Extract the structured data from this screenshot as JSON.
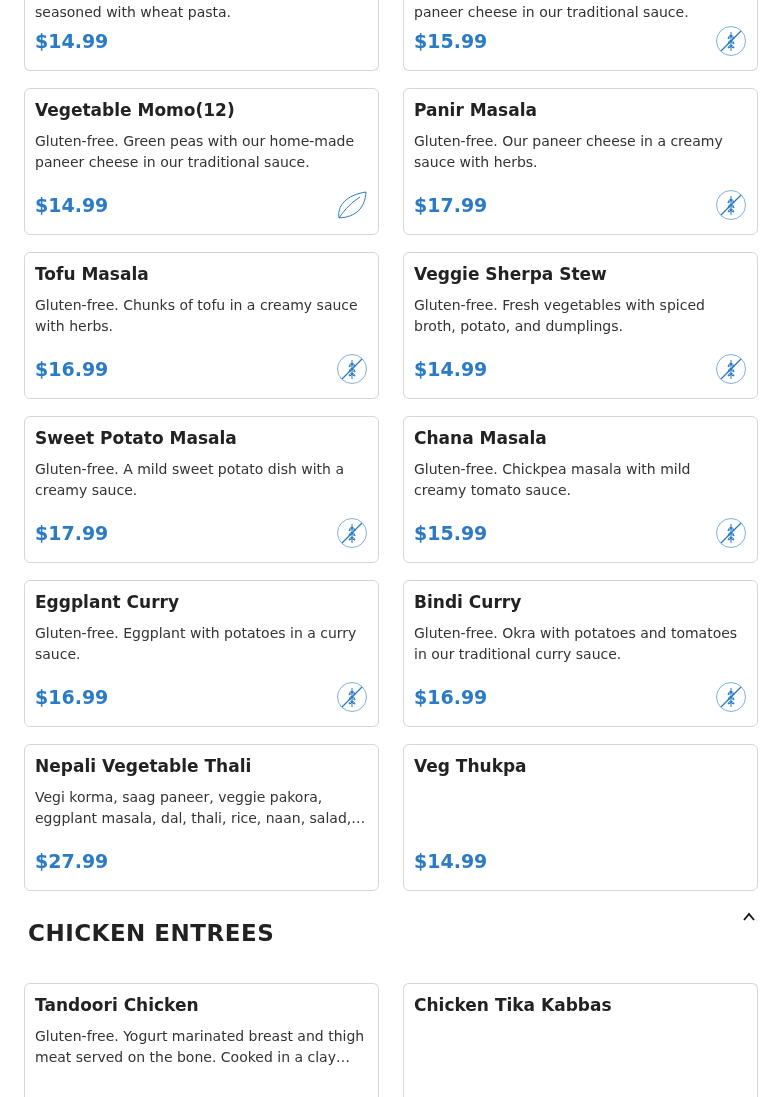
{
  "top_items": [
    {
      "description": "seasoned with wheat pasta.",
      "price": "$14.99",
      "kind": "plain"
    },
    {
      "description": "paneer cheese in our traditional sauce.",
      "price": "$15.99",
      "kind": "gluten_free"
    }
  ],
  "items": [
    {
      "name": "Vegetable Momo(12)",
      "description": "Gluten-free. Green peas with our home-made paneer cheese in our traditional sauce.",
      "price": "$14.99",
      "kind": "leaf"
    },
    {
      "name": "Panir Masala",
      "description": "Gluten-free. Our paneer cheese in a creamy sauce with herbs.",
      "price": "$17.99",
      "kind": "gluten_free"
    },
    {
      "name": "Tofu Masala",
      "description": "Gluten-free. Chunks of tofu in a creamy sauce with herbs.",
      "price": "$16.99",
      "kind": "gluten_free"
    },
    {
      "name": "Veggie Sherpa Stew",
      "description": "Gluten-free. Fresh vegetables with spiced broth, potato, and dumplings.",
      "price": "$14.99",
      "kind": "gluten_free"
    },
    {
      "name": "Sweet Potato Masala",
      "description": "Gluten-free. A mild sweet potato dish with a creamy sauce.",
      "price": "$17.99",
      "kind": "gluten_free"
    },
    {
      "name": "Chana Masala",
      "description": "Gluten-free. Chickpea masala with mild creamy tomato sauce.",
      "price": "$15.99",
      "kind": "gluten_free"
    },
    {
      "name": "Eggplant Curry",
      "description": "Gluten-free. Eggplant with potatoes in a curry sauce.",
      "price": "$16.99",
      "kind": "gluten_free"
    },
    {
      "name": "Bindi Curry",
      "description": "Gluten-free. Okra with potatoes and tomatoes in our traditional curry sauce.",
      "price": "$16.99",
      "kind": "gluten_free"
    },
    {
      "name": "Nepali Vegetable Thali",
      "description": "Vegi korma, saag paneer, veggie pakora, eggplant masala, dal, thali, rice, naan, salad,…",
      "price": "$27.99",
      "kind": "plain"
    },
    {
      "name": "Veg Thukpa",
      "price": "$14.99",
      "kind": "plain"
    }
  ],
  "section": {
    "title": "CHICKEN ENTREES",
    "expanded": true,
    "items": [
      {
        "name": "Tandoori Chicken",
        "description": "Gluten-free. Yogurt marinated breast and thigh meat served on the bone. Cooked in a clay…"
      },
      {
        "name": "Chicken Tika Kabbas"
      }
    ]
  }
}
